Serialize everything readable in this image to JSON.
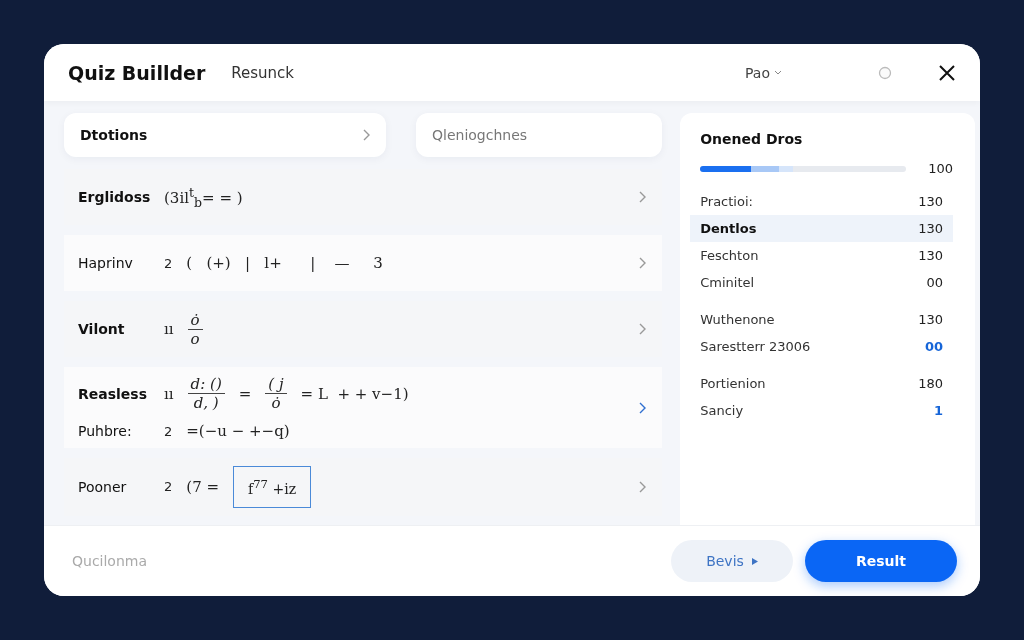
{
  "window": {
    "title": "Quiz Buillder",
    "subtitle": "Resunck",
    "menu": "Pao"
  },
  "top": {
    "section": "Dtotions",
    "search": {
      "placeholder": "Qleniogchnes"
    }
  },
  "rows": [
    {
      "label": "Erglidoss",
      "bold": true,
      "number": "",
      "highlighted": false,
      "tokens": [
        {
          "kind": "text",
          "text": "(3il$^{t}$$_{b}$= = )"
        }
      ],
      "extra": null
    },
    {
      "label": "Haprinv",
      "bold": false,
      "number": "2",
      "highlighted": false,
      "tokens": [
        {
          "kind": "text",
          "text": "(   (+)   |   l+      |    —     3"
        }
      ],
      "extra": null
    },
    {
      "label": "Vilont",
      "bold": true,
      "number": "",
      "highlighted": false,
      "tokens": [
        {
          "kind": "text",
          "text": "ıı"
        },
        {
          "kind": "frac",
          "num": "ȯ",
          "den": "o"
        }
      ],
      "extra": null
    },
    {
      "label": "Reasless",
      "bold": true,
      "number": "",
      "highlighted": true,
      "tokens": [
        {
          "kind": "text",
          "text": "ıı"
        },
        {
          "kind": "frac",
          "num": "d: ()",
          "den": "d, )"
        },
        {
          "kind": "text",
          "text": "="
        },
        {
          "kind": "frac",
          "num": "( j",
          "den": "ȯ"
        },
        {
          "kind": "text",
          "text": "= L  + + v−1)"
        }
      ],
      "extra": {
        "label": "Puhbre:",
        "number": "2",
        "text": "=(−u − +−q)"
      }
    },
    {
      "label": "Pooner",
      "bold": false,
      "number": "2",
      "highlighted": false,
      "tokens": [
        {
          "kind": "text",
          "text": "(7 ="
        },
        {
          "kind": "boxed",
          "text": "f$^{77}$ +iz"
        }
      ],
      "extra": null
    }
  ],
  "panel": {
    "title": "Onened Dros",
    "progress": {
      "level": 0.45,
      "reading": "100"
    },
    "groups": [
      [
        {
          "label": "Practioi:",
          "value": "130",
          "selected": false,
          "accent": false
        },
        {
          "label": "Dentlos",
          "value": "130",
          "selected": true,
          "accent": false
        },
        {
          "label": "Feschton",
          "value": "130",
          "selected": false,
          "accent": false
        },
        {
          "label": "Cminitel",
          "value": "00",
          "selected": false,
          "accent": false
        }
      ],
      [
        {
          "label": "Wuthenone",
          "value": "130",
          "selected": false,
          "accent": false
        },
        {
          "label": "Sarestterr 23006",
          "value": "00",
          "selected": false,
          "accent": true
        }
      ],
      [
        {
          "label": "Portienion",
          "value": "180",
          "selected": false,
          "accent": false
        },
        {
          "label": "Sanciy",
          "value": "1",
          "selected": false,
          "accent": true
        }
      ]
    ]
  },
  "footer": {
    "note": "Qucilonma",
    "secondary": "Bevis",
    "primary": "Result"
  }
}
